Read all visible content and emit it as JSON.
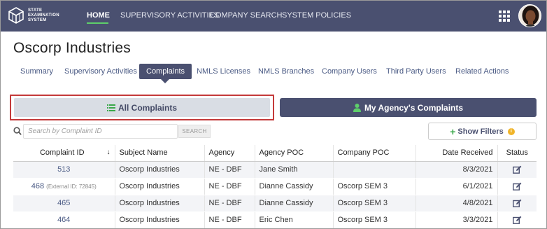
{
  "nav": {
    "logo_lines": [
      "STATE",
      "EXAMINATION",
      "SYSTEM"
    ],
    "items": [
      "HOME",
      "SUPERVISORY ACTIVITIES",
      "COMPANY SEARCH",
      "SYSTEM POLICIES"
    ],
    "active": "HOME",
    "apps_icon": "grid-apps-icon",
    "accent_color": "#5ecf6a",
    "bar_color": "#4a5070"
  },
  "page": {
    "title": "Oscorp Industries"
  },
  "tabs": [
    "Summary",
    "Supervisory Activities",
    "Complaints",
    "NMLS Licenses",
    "NMLS Branches",
    "Company Users",
    "Third Party Users",
    "Related Actions"
  ],
  "active_tab": "Complaints",
  "complaint_filters": {
    "all_label": "All Complaints",
    "agency_label": "My Agency's Complaints",
    "highlight_color": "#c43a3a"
  },
  "search": {
    "placeholder": "Search by Complaint ID",
    "button_label": "SEARCH",
    "filters_label": "Show Filters",
    "info_badge": "i"
  },
  "table": {
    "columns": [
      "Complaint ID",
      "Subject Name",
      "Agency",
      "Agency POC",
      "Company POC",
      "Date Received",
      "Status"
    ],
    "sort_indicator": "↓",
    "rows": [
      {
        "id": "513",
        "ext": "",
        "subject": "Oscorp Industries",
        "agency": "NE - DBF",
        "agency_poc": "Jane Smith",
        "company_poc": "",
        "date": "8/3/2021"
      },
      {
        "id": "468",
        "ext": "(External ID: 72845)",
        "subject": "Oscorp Industries",
        "agency": "NE - DBF",
        "agency_poc": "Dianne Cassidy",
        "company_poc": "Oscorp SEM 3",
        "date": "6/1/2021"
      },
      {
        "id": "465",
        "ext": "",
        "subject": "Oscorp Industries",
        "agency": "NE - DBF",
        "agency_poc": "Dianne Cassidy",
        "company_poc": "Oscorp SEM 3",
        "date": "4/8/2021"
      },
      {
        "id": "464",
        "ext": "",
        "subject": "Oscorp Industries",
        "agency": "NE - DBF",
        "agency_poc": "Eric Chen",
        "company_poc": "Oscorp SEM 3",
        "date": "3/3/2021"
      }
    ]
  }
}
